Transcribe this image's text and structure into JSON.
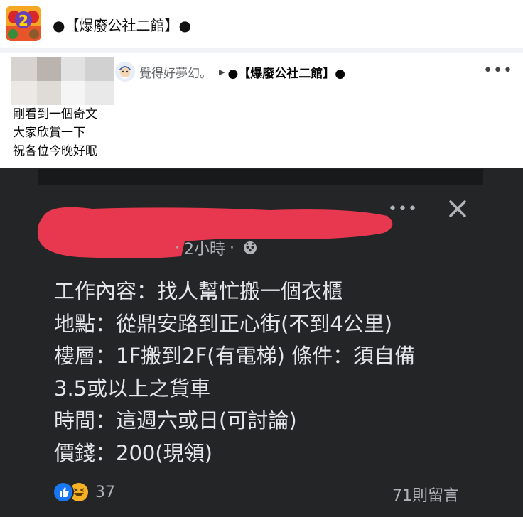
{
  "group": {
    "name": "●【爆廢公社二館】●",
    "icon": "group-logo-icon"
  },
  "post": {
    "author": "覺得好夢幻。",
    "arrow": "▶",
    "target_group": "●【爆廢公社二館】●",
    "more": "•••",
    "lines": [
      "剛看到一個奇文",
      "大家欣賞一下",
      "祝各位今晚好眠"
    ]
  },
  "screenshot": {
    "more": "•••",
    "time": "2小時",
    "dot": "·",
    "lines": [
      "工作內容：找人幫忙搬一個衣櫃",
      "地點：從鼎安路到正心街(不到4公里)",
      "樓層：1F搬到2F(有電梯) 條件：須自備",
      "3.5或以上之貨車",
      "時間：這週六或日(可討論)",
      "價錢：200(現領)"
    ],
    "reaction_count": "37",
    "comments": "71則留言"
  },
  "colors": {
    "dark_bg": "#242526",
    "redaction": "#e8384f",
    "like": "#1877f2",
    "haha": "#f7b125"
  }
}
